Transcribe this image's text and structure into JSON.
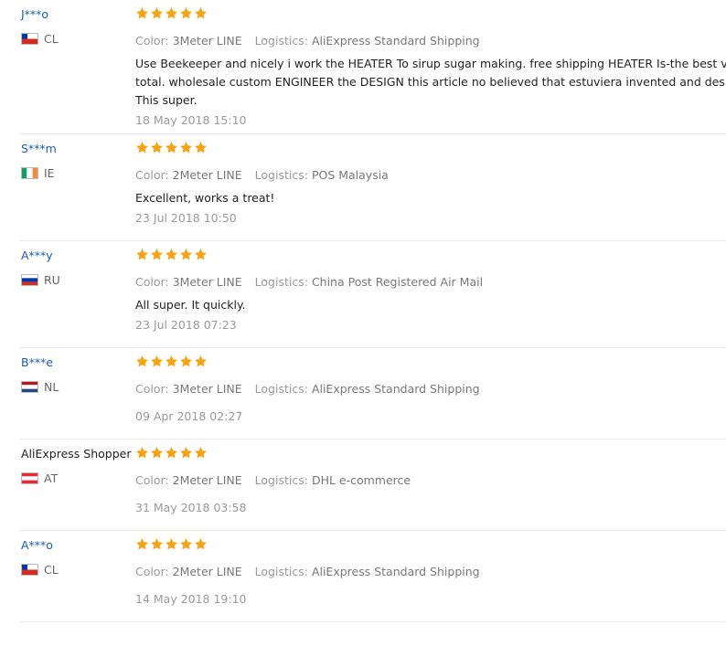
{
  "colors": {
    "star": "#f7a30f",
    "username_link": "#1a5fb4",
    "text": "#222222",
    "muted": "#999999",
    "divider": "#e8e8e8"
  },
  "star_icon": "star-icon",
  "reviews": [
    {
      "user": "J***o",
      "country": "CL",
      "rating": 5,
      "color_label": "Color:",
      "color_value": "3Meter LINE",
      "logistics_label": "Logistics:",
      "logistics_value": "AliExpress Standard Shipping",
      "text_lines": [
        "Use Beekeeper and nicely i work the HEATER To sirup sugar making. free shipping HEATER Is-the best very fast and well. To",
        "total. wholesale custom ENGINEER the DESIGN this article no believed that estuviera invented and designed in China",
        "This super."
      ],
      "date": "18 May 2018 15:10"
    },
    {
      "user": "S***m",
      "country": "IE",
      "rating": 5,
      "color_label": "Color:",
      "color_value": "2Meter LINE",
      "logistics_label": "Logistics:",
      "logistics_value": "POS Malaysia",
      "text_lines": [
        "Excellent, works a treat!"
      ],
      "date": "23 Jul 2018 10:50"
    },
    {
      "user": "A***y",
      "country": "RU",
      "rating": 5,
      "color_label": "Color:",
      "color_value": "3Meter LINE",
      "logistics_label": "Logistics:",
      "logistics_value": "China Post Registered Air Mail",
      "text_lines": [
        "All super. It quickly."
      ],
      "date": "23 Jul 2018 07:23"
    },
    {
      "user": "B***e",
      "country": "NL",
      "rating": 5,
      "color_label": "Color:",
      "color_value": "3Meter LINE",
      "logistics_label": "Logistics:",
      "logistics_value": "AliExpress Standard Shipping",
      "text_lines": [],
      "date": "09 Apr 2018 02:27"
    },
    {
      "user": "AliExpress Shopper",
      "country": "AT",
      "rating": 5,
      "color_label": "Color:",
      "color_value": "2Meter LINE",
      "logistics_label": "Logistics:",
      "logistics_value": "DHL e-commerce",
      "text_lines": [],
      "date": "31 May 2018 03:58"
    },
    {
      "user": "A***o",
      "country": "CL",
      "rating": 5,
      "color_label": "Color:",
      "color_value": "2Meter LINE",
      "logistics_label": "Logistics:",
      "logistics_value": "AliExpress Standard Shipping",
      "text_lines": [],
      "date": "14 May 2018 19:10"
    }
  ]
}
